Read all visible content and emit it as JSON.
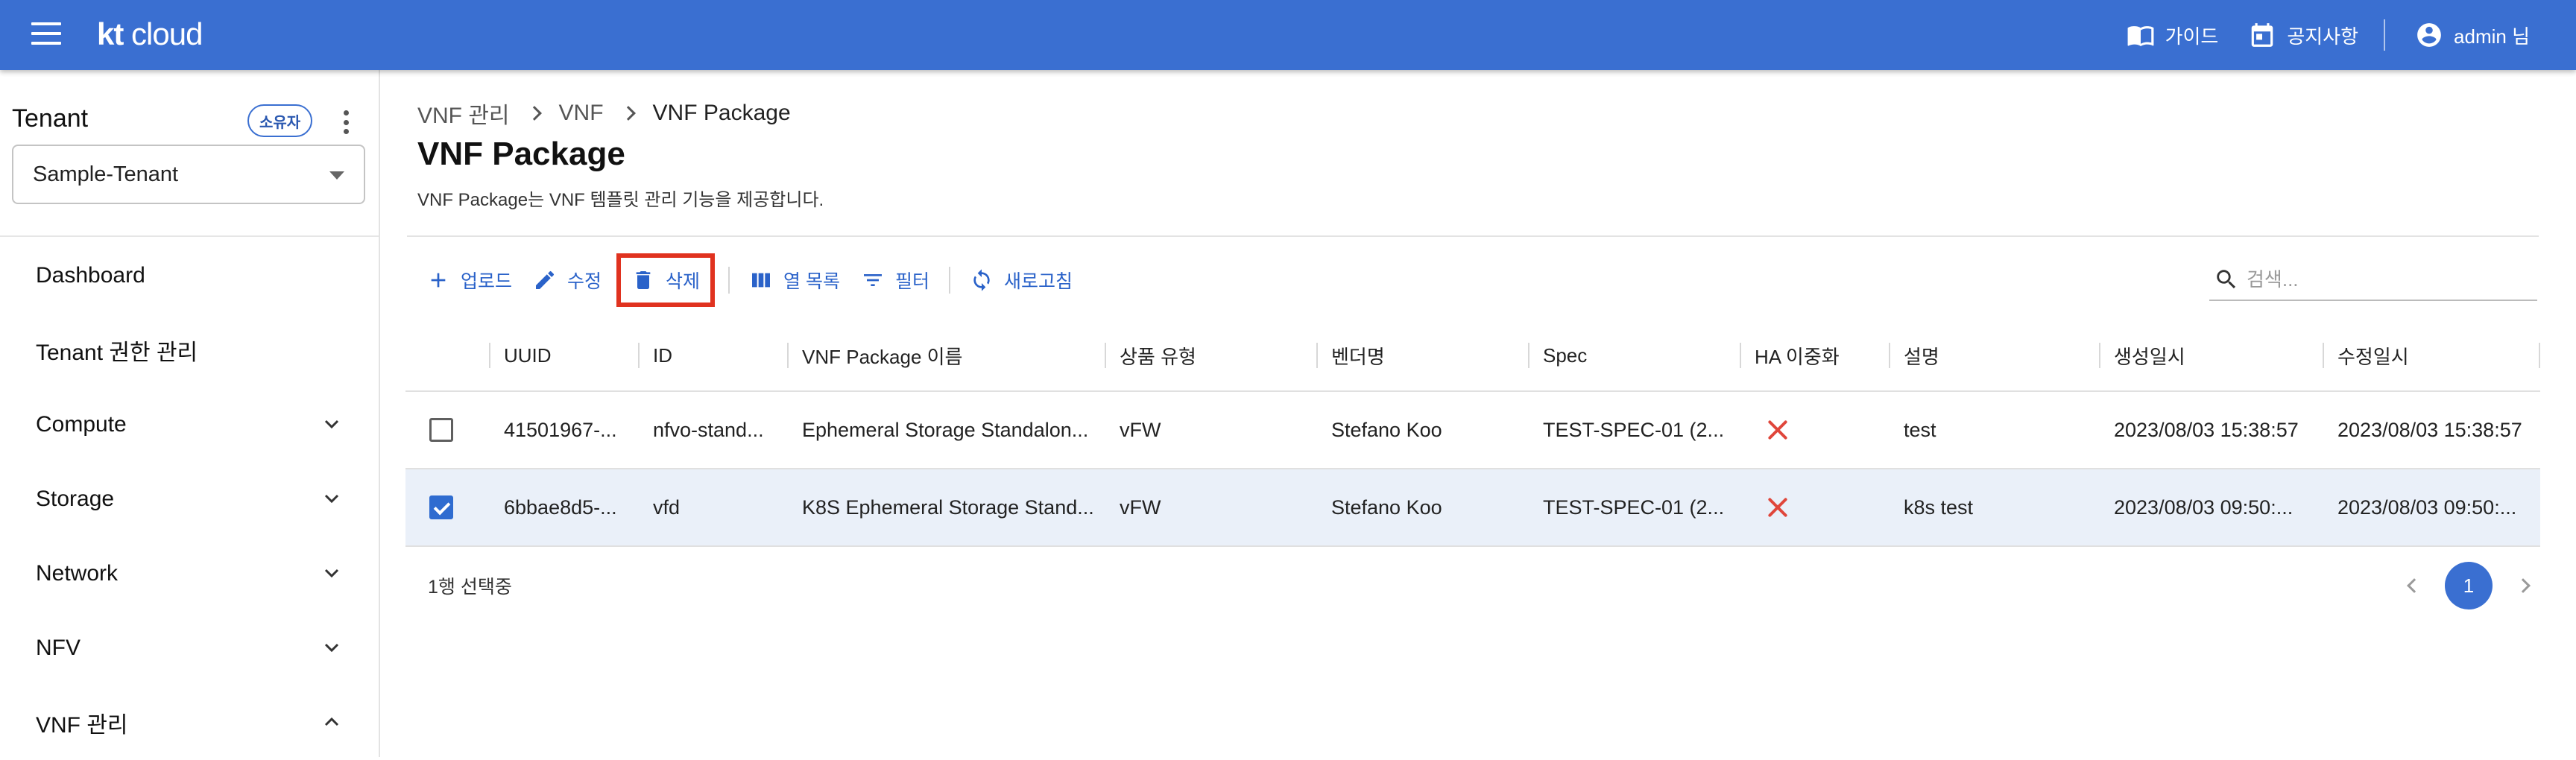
{
  "appbar": {
    "logo_bold": "kt",
    "logo_light": " cloud",
    "guide_label": "가이드",
    "notice_label": "공지사항",
    "user_label": "admin 님",
    "bg_color": "#3a6fd1"
  },
  "sidebar": {
    "tenant_title": "Tenant",
    "owner_badge": "소유자",
    "tenant_value": "Sample-Tenant",
    "items": [
      {
        "label": "Dashboard",
        "expand": "none"
      },
      {
        "label": "Tenant 권한 관리",
        "expand": "none"
      },
      {
        "label": "Compute",
        "expand": "down"
      },
      {
        "label": "Storage",
        "expand": "down"
      },
      {
        "label": "Network",
        "expand": "down"
      },
      {
        "label": "NFV",
        "expand": "down"
      },
      {
        "label": "VNF 관리",
        "expand": "up"
      }
    ]
  },
  "breadcrumb": [
    "VNF 관리",
    "VNF",
    "VNF Package"
  ],
  "page": {
    "title": "VNF Package",
    "description": "VNF Package는 VNF 템플릿 관리 기능을 제공합니다."
  },
  "toolbar": {
    "upload": "업로드",
    "edit": "수정",
    "delete": "삭제",
    "columns": "열 목록",
    "filter": "필터",
    "refresh": "새로고침",
    "highlight_color": "#e0321f"
  },
  "search": {
    "placeholder": "검색..."
  },
  "table": {
    "columns": [
      "UUID",
      "ID",
      "VNF Package 이름",
      "상품 유형",
      "벤더명",
      "Spec",
      "HA 이중화",
      "설명",
      "생성일시",
      "수정일시"
    ],
    "rows": [
      {
        "checked": false,
        "uuid": "41501967-...",
        "id": "nfvo-stand...",
        "name": "Ephemeral Storage Standalon...",
        "type": "vFW",
        "vendor": "Stefano Koo",
        "spec": "TEST-SPEC-01 (2...",
        "ha": "x",
        "desc": "test",
        "created": "2023/08/03 15:38:57",
        "modified": "2023/08/03 15:38:57"
      },
      {
        "checked": true,
        "uuid": "6bbae8d5-...",
        "id": "vfd",
        "name": "K8S Ephemeral Storage Stand...",
        "type": "vFW",
        "vendor": "Stefano Koo",
        "spec": "TEST-SPEC-01 (2...",
        "ha": "x",
        "desc": "k8s test",
        "created": "2023/08/03 09:50:...",
        "modified": "2023/08/03 09:50:..."
      }
    ],
    "selected_text": "1행 선택중",
    "current_page": "1"
  }
}
